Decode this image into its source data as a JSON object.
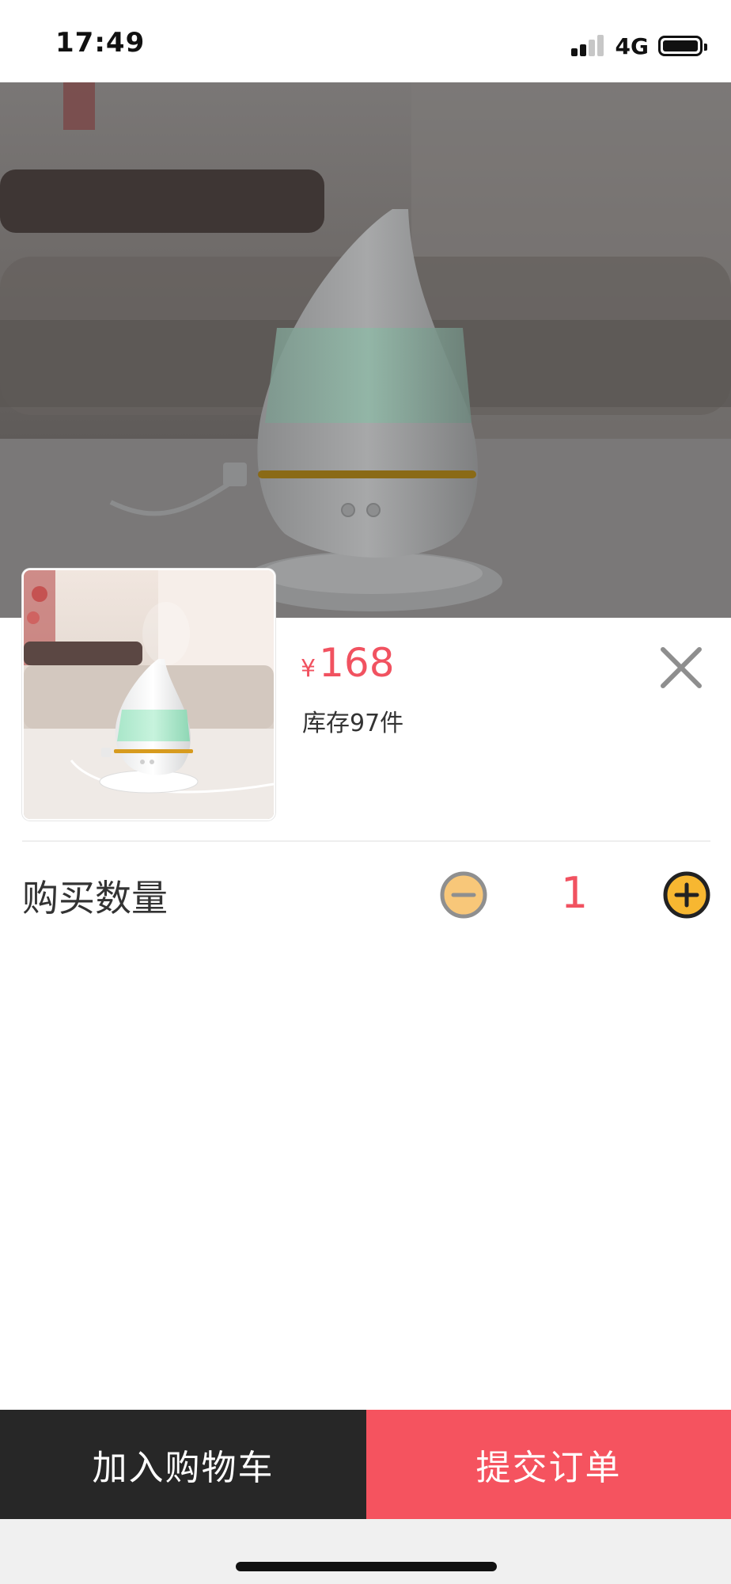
{
  "status_bar": {
    "time": "17:49",
    "network": "4G",
    "icons": [
      "signal-icon",
      "battery-icon"
    ]
  },
  "product": {
    "price_symbol": "¥",
    "price": "168",
    "stock": "库存97件",
    "images": [
      "humidifier-photo"
    ]
  },
  "quantity": {
    "label": "购买数量",
    "value": "1",
    "minus_icon": "minus-circle-icon",
    "plus_icon": "plus-circle-icon"
  },
  "actions": {
    "add_to_cart": "加入购物车",
    "submit_order": "提交订单"
  },
  "colors": {
    "accent": "#f15260",
    "submit_bg": "#f5535f",
    "cart_bg": "#272727",
    "stepper_yellow": "#f7b731"
  }
}
